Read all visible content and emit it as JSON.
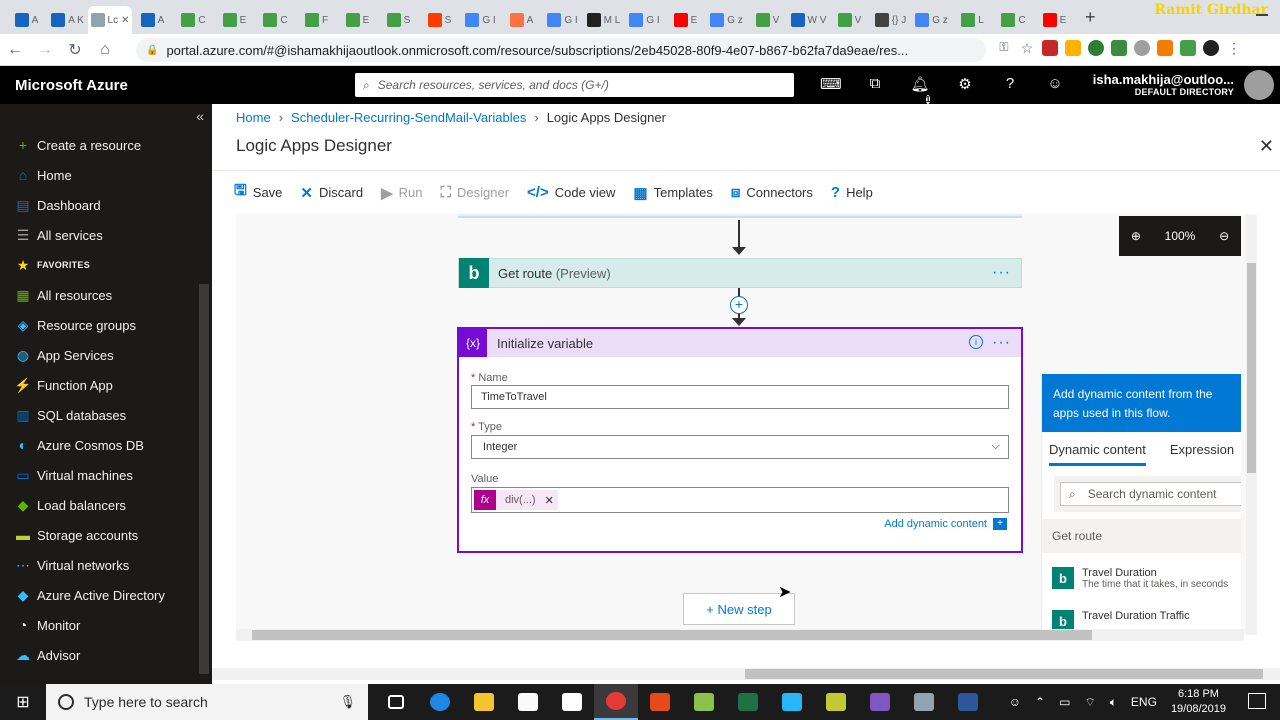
{
  "browser": {
    "tab_titles": [
      "A",
      "A K",
      "Lc",
      "A",
      "C",
      "E",
      "C",
      "F",
      "E",
      "S",
      "S",
      "G I",
      "A",
      "G I",
      "M L",
      "G I",
      "E",
      "G z",
      "V",
      "W V",
      "V",
      "{} J",
      "G z",
      "L",
      "C",
      "E"
    ],
    "active_tab_index": 2,
    "active_tab_close": "✕",
    "new_tab": "+",
    "url": "portal.azure.com/#@ishamakhijaoutlook.onmicrosoft.com/resource/subscriptions/2eb45028-80f9-4e07-b867-b62fa7da9eae/res...",
    "watermark": "Ramit Girdhar"
  },
  "azure": {
    "brand": "Microsoft Azure",
    "search_placeholder": "Search resources, services, and docs (G+/)",
    "notification_count": "1",
    "user_email": "isha.makhija@outloo...",
    "user_directory": "DEFAULT DIRECTORY"
  },
  "sidebar": {
    "items": [
      {
        "label": "Create a resource",
        "icon": "plus-icon",
        "color": "#5db300"
      },
      {
        "label": "Home",
        "icon": "home-icon",
        "color": "#0078d4"
      },
      {
        "label": "Dashboard",
        "icon": "dashboard-icon",
        "color": "#0078d4"
      },
      {
        "label": "All services",
        "icon": "list-icon",
        "color": "#a19f9d"
      },
      {
        "label": "FAVORITES",
        "icon": "star-icon",
        "color": "#ffd700"
      },
      {
        "label": "All resources",
        "icon": "grid-icon",
        "color": "#5db300"
      },
      {
        "label": "Resource groups",
        "icon": "cube-icon",
        "color": "#32bfff"
      },
      {
        "label": "App Services",
        "icon": "globe-icon",
        "color": "#32bfff"
      },
      {
        "label": "Function App",
        "icon": "bolt-icon",
        "color": "#ffb900"
      },
      {
        "label": "SQL databases",
        "icon": "database-icon",
        "color": "#0078d4"
      },
      {
        "label": "Azure Cosmos DB",
        "icon": "planet-icon",
        "color": "#32bfff"
      },
      {
        "label": "Virtual machines",
        "icon": "monitor-icon",
        "color": "#0078d4"
      },
      {
        "label": "Load balancers",
        "icon": "diamond-icon",
        "color": "#5db300"
      },
      {
        "label": "Storage accounts",
        "icon": "storage-icon",
        "color": "#b8d432"
      },
      {
        "label": "Virtual networks",
        "icon": "network-icon",
        "color": "#32bfff"
      },
      {
        "label": "Azure Active Directory",
        "icon": "pyramid-icon",
        "color": "#32bfff"
      },
      {
        "label": "Monitor",
        "icon": "gauge-icon",
        "color": "#ffffff"
      },
      {
        "label": "Advisor",
        "icon": "cloud-icon",
        "color": "#32bfff"
      }
    ]
  },
  "main": {
    "breadcrumb": [
      "Home",
      "Scheduler-Recurring-SendMail-Variables",
      "Logic Apps Designer"
    ],
    "title": "Logic Apps Designer",
    "toolbar": {
      "save": "Save",
      "discard": "Discard",
      "run": "Run",
      "designer": "Designer",
      "code_view": "Code view",
      "templates": "Templates",
      "connectors": "Connectors",
      "help": "Help"
    },
    "zoom": "100%"
  },
  "flow": {
    "get_route": {
      "title": "Get route",
      "preview": "(Preview)"
    },
    "init_var": {
      "title": "Initialize variable",
      "icon_text": "{x}",
      "name_label": "Name",
      "name_value": "TimeToTravel",
      "type_label": "Type",
      "type_value": "Integer",
      "value_label": "Value",
      "token_fx": "fx",
      "token_text": "div(...)",
      "add_dynamic": "Add dynamic content"
    },
    "new_step": "+ New step"
  },
  "dynamic_panel": {
    "header": "Add dynamic content from the apps used in this flow.",
    "tabs": [
      "Dynamic content",
      "Expression"
    ],
    "search_placeholder": "Search dynamic content",
    "group": "Get route",
    "items": [
      {
        "title": "Travel Duration",
        "desc": "The time that it takes, in seconds"
      },
      {
        "title": "Travel Duration Traffic",
        "desc": ""
      }
    ]
  },
  "taskbar": {
    "search_placeholder": "Type here to search",
    "language": "ENG",
    "time": "6:18 PM",
    "date": "19/08/2019"
  }
}
